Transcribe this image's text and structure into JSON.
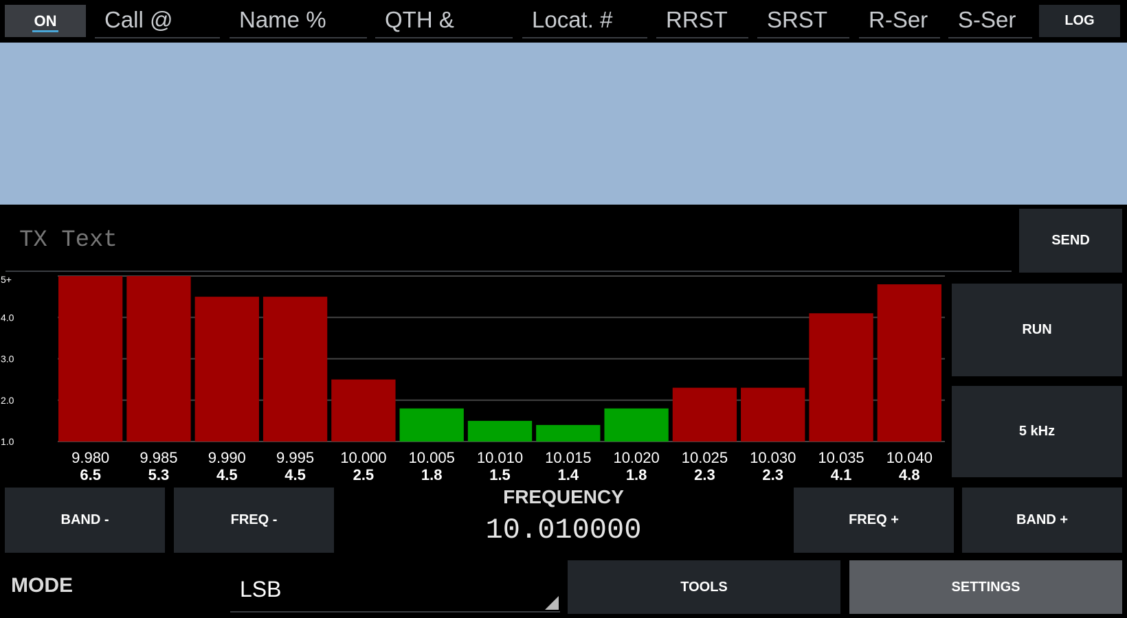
{
  "header": {
    "on_label": "ON",
    "fields": [
      "Call @",
      "Name %",
      "QTH &",
      "Locat. #",
      "RRST",
      "SRST",
      "R-Ser",
      "S-Ser"
    ],
    "log_label": "LOG"
  },
  "tx": {
    "placeholder": "TX Text",
    "send_label": "SEND"
  },
  "side": {
    "run_label": "RUN",
    "span_label": "5 kHz"
  },
  "freq_controls": {
    "band_minus": "BAND -",
    "freq_minus": "FREQ -",
    "freq_plus": "FREQ +",
    "band_plus": "BAND +",
    "title": "FREQUENCY",
    "value": "10.010000"
  },
  "mode": {
    "label": "MODE",
    "value": "LSB"
  },
  "bottom": {
    "tools_label": "TOOLS",
    "settings_label": "SETTINGS"
  },
  "colors": {
    "bar_bad": "#a00000",
    "bar_good": "#00a300",
    "rx_background": "#9bb6d4"
  },
  "chart_data": {
    "type": "bar",
    "categories": [
      "9.980",
      "9.985",
      "9.990",
      "9.995",
      "10.000",
      "10.005",
      "10.010",
      "10.015",
      "10.020",
      "10.025",
      "10.030",
      "10.035",
      "10.040"
    ],
    "values": [
      6.5,
      5.3,
      4.5,
      4.5,
      2.5,
      1.8,
      1.5,
      1.4,
      1.8,
      2.3,
      2.3,
      4.1,
      4.8
    ],
    "value_labels": [
      "6.5",
      "5.3",
      "4.5",
      "4.5",
      "2.5",
      "1.8",
      "1.5",
      "1.4",
      "1.8",
      "2.3",
      "2.3",
      "4.1",
      "4.8"
    ],
    "y_ticks": [
      "1.0",
      "2.0",
      "3.0",
      "4.0",
      "5+"
    ],
    "ylim": [
      1.0,
      5.0
    ],
    "good_threshold": 2.0,
    "grid": true
  }
}
